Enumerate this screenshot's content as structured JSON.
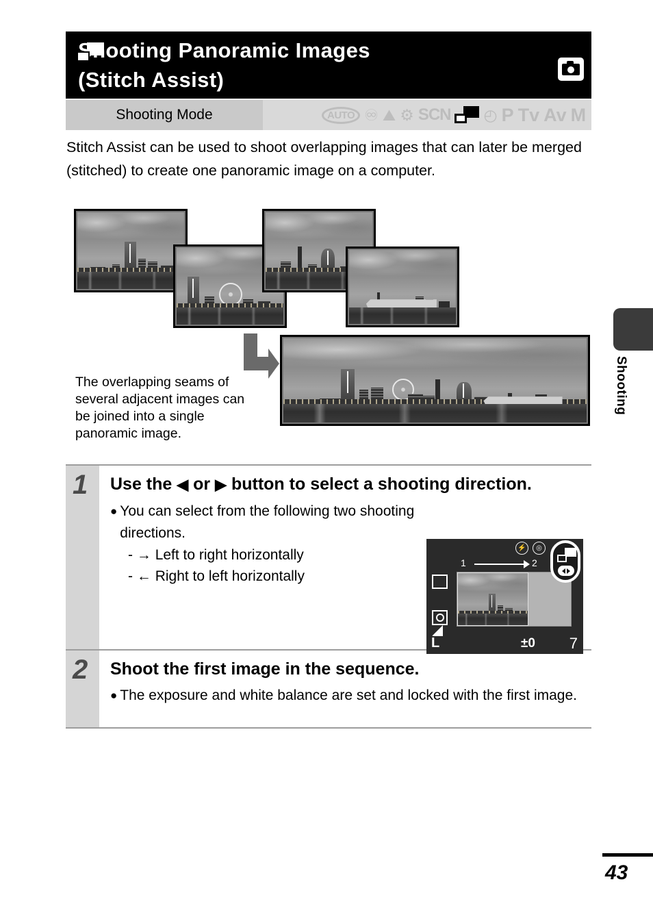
{
  "header": {
    "icon": "stitch-assist-icon",
    "title": "Shooting Panoramic Images\n(Stitch Assist)",
    "badge_icon": "camera-icon"
  },
  "mode_bar": {
    "label": "Shooting Mode",
    "modes": [
      {
        "name": "auto",
        "label": "AUTO",
        "active": false
      },
      {
        "name": "portrait",
        "label": "♁",
        "active": false
      },
      {
        "name": "landscape",
        "label": "⛰",
        "active": false
      },
      {
        "name": "night-snapshot",
        "label": "⚑",
        "active": false
      },
      {
        "name": "scene",
        "label": "SCN",
        "active": false
      },
      {
        "name": "stitch-assist",
        "label": "",
        "active": true
      },
      {
        "name": "movie",
        "label": "Ἲ5",
        "active": false
      },
      {
        "name": "program",
        "label": "P",
        "active": false
      },
      {
        "name": "shutter-priority",
        "label": "Tv",
        "active": false
      },
      {
        "name": "aperture-priority",
        "label": "Av",
        "active": false
      },
      {
        "name": "manual",
        "label": "M",
        "active": false
      }
    ]
  },
  "intro": "Stitch Assist can be used to shoot overlapping images that can later be merged (stitched) to create one panoramic image on a computer.",
  "illustration": {
    "caption": "The overlapping seams of several adjacent images can be joined into a single panoramic image.",
    "arrow_icon": "bent-arrow-right-icon",
    "source_photos": [
      {
        "name": "source-photo-1",
        "alt": "Yokohama skyline segment 1 with Landmark Tower"
      },
      {
        "name": "source-photo-2",
        "alt": "Yokohama skyline segment 2 with ferris wheel"
      },
      {
        "name": "source-photo-3",
        "alt": "Yokohama skyline segment 3 with towers"
      },
      {
        "name": "source-photo-4",
        "alt": "Yokohama skyline segment 4 with ship"
      }
    ],
    "result_photo": {
      "name": "panorama-result-photo",
      "alt": "Stitched Yokohama panorama"
    }
  },
  "steps": [
    {
      "number": "1",
      "title_before": "Use the",
      "title_arrow_left": "◀",
      "title_or": "or",
      "title_arrow_right": "▶",
      "title_after": "button to select a shooting direction.",
      "bullet": "You can select from the following two shooting directions.",
      "sub_items": [
        {
          "dash": "-",
          "arrow": "→",
          "text": "Left to right horizontally"
        },
        {
          "dash": "-",
          "arrow": "←",
          "text": "Right to left horizontally"
        }
      ]
    },
    {
      "number": "2",
      "title": "Shoot the first image in the sequence.",
      "bullet": "The exposure and white balance are set and locked with the first image."
    }
  ],
  "lcd": {
    "flash_off_icon": "flash-off-icon",
    "red_eye_icon": "red-eye-icon",
    "frame_from": "1",
    "frame_to": "2",
    "af_frame_icon": "af-frame-icon",
    "metering_icon": "evaluative-metering-icon",
    "quality_icon": "fine-quality-icon",
    "image_size": "L",
    "exposure": "±0",
    "shots_remaining": "7",
    "badge": {
      "stitch_icon": "stitch-assist-icon",
      "pad_icon": "left-right-pad-icon"
    }
  },
  "side_tab": {
    "label": "Shooting"
  },
  "footer": {
    "page_number": "43"
  },
  "colors": {
    "header_bg": "#000000",
    "mode_label_bg": "#c9c9c9",
    "mode_icons_bg": "#d9d9d9",
    "step_col_bg": "#d5d5d5",
    "step_num": "#4a4a4a",
    "tab_bg": "#3b3b3b",
    "lcd_bg": "#2a2a2a"
  }
}
